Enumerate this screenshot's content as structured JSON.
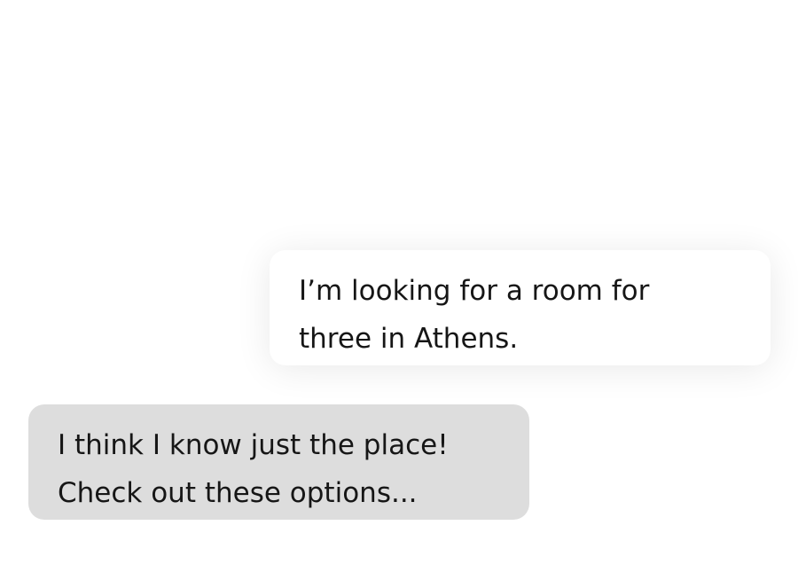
{
  "conversation": {
    "messages": [
      {
        "sender": "user",
        "lines": [
          "I’m looking for a room for",
          "three in Athens."
        ]
      },
      {
        "sender": "assistant",
        "lines": [
          "I think I know just the place!",
          "Check out these options..."
        ]
      }
    ]
  },
  "colors": {
    "page_background": "#ffffff",
    "outgoing_bubble": "#ffffff",
    "incoming_bubble": "#dddddd",
    "text": "#161616"
  }
}
